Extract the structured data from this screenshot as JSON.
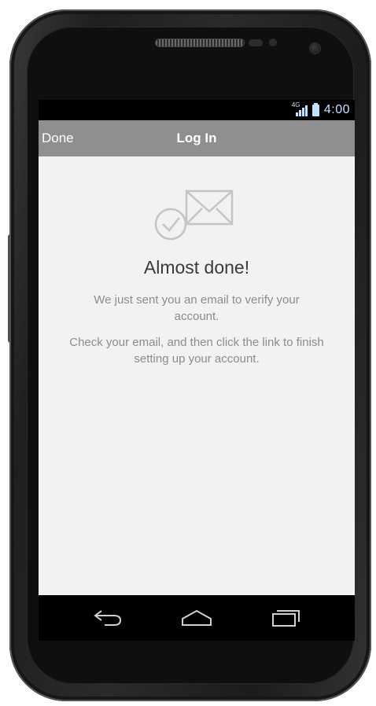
{
  "status_bar": {
    "network": "4G",
    "time": "4:00",
    "icon_color": "#bfe3ff"
  },
  "title_bar": {
    "done_label": "Done",
    "title": "Log In",
    "background": "#8f8f8f"
  },
  "content": {
    "icon": "mail-check-icon",
    "heading": "Almost done!",
    "message_1": "We just sent you an email to verify your account.",
    "message_2": "Check your email, and then click the link to finish setting up your account."
  },
  "nav_bar": {
    "icons": [
      "back-icon",
      "home-icon",
      "recents-icon"
    ]
  }
}
